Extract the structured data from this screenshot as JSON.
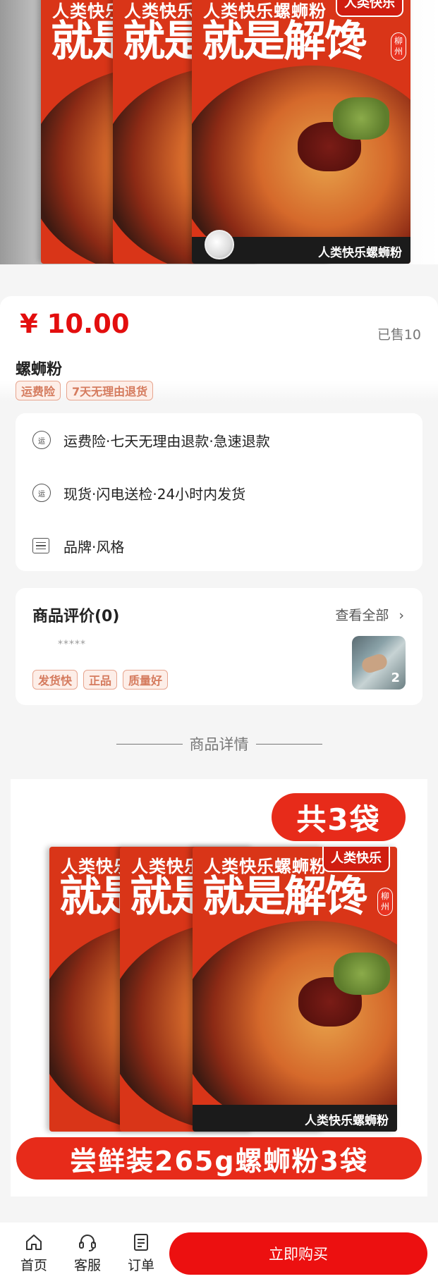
{
  "hero": {
    "pack_brand": "人类快乐螺蛳粉",
    "pack_slogan": "就是解馋",
    "pack_tag": "人类快乐",
    "pack_side": "柳州",
    "pack_footer": "人类快乐螺蛳粉"
  },
  "product": {
    "price": "¥ 10.00",
    "sold": "已售10",
    "title": "螺蛳粉",
    "badges": [
      "运费险",
      "7天无理由退货"
    ]
  },
  "services": [
    {
      "icon": "shipping-insurance-icon",
      "icon_text": "运",
      "text": "运费险·七天无理由退款·急速退款"
    },
    {
      "icon": "shipping-icon",
      "icon_text": "运",
      "text": "现货·闪电送检·24小时内发货"
    },
    {
      "icon": "list-icon",
      "icon_text": "",
      "text": "品牌·风格"
    }
  ],
  "reviews": {
    "title": "商品评价(0)",
    "view_all": "查看全部",
    "stars": "*****",
    "tags": [
      "发货快",
      "正品",
      "质量好"
    ],
    "photo_count": "2"
  },
  "detail": {
    "header": "商品详情",
    "count_label": "共3袋",
    "bottom_label": "尝鲜装265g螺蛳粉3袋"
  },
  "bottom_nav": {
    "home": "首页",
    "service": "客服",
    "orders": "订单",
    "buy": "立即购买"
  }
}
